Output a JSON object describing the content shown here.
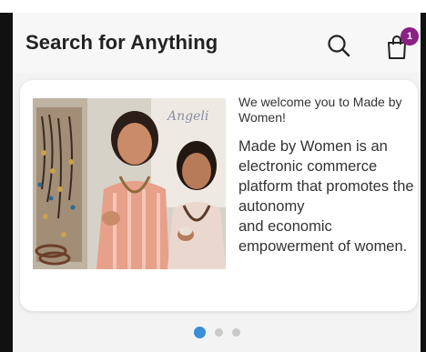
{
  "header": {
    "title": "Search for Anything",
    "search_icon": "search-icon",
    "bag_icon": "shopping-bag-icon",
    "bag_badge_count": "1",
    "badge_color": "#8a1f86"
  },
  "carousel": {
    "slide": {
      "welcome_text": "We welcome you to Made by Women!",
      "description": "Made by Women is an electronic commerce platform that promotes the autonomy\nand economic empowerment of women.",
      "image_alt": "two smiling women holding handmade jewelry"
    },
    "dots": {
      "count": 3,
      "active_index": 0,
      "active_color": "#3b8fd6"
    }
  }
}
